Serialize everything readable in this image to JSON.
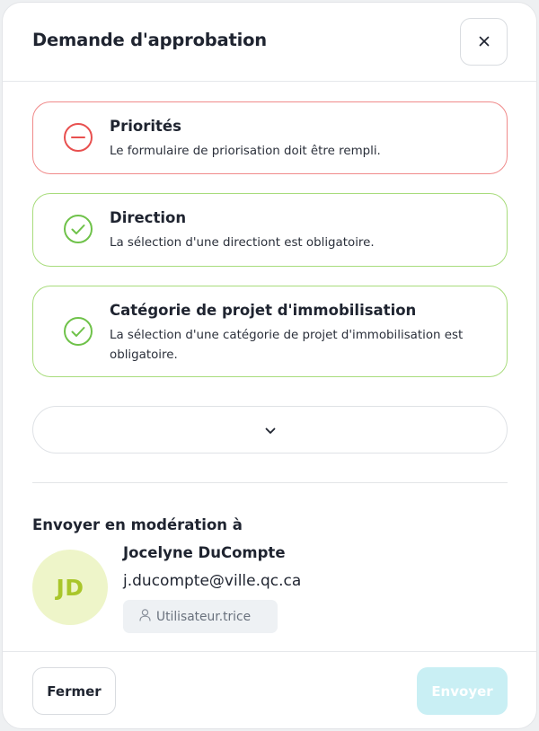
{
  "dialog": {
    "title": "Demande d'approbation",
    "close_icon": "close-icon"
  },
  "checks": [
    {
      "status": "error",
      "icon": "minus-circle-icon",
      "title": "Priorités",
      "description": "Le formulaire de priorisation doit être rempli."
    },
    {
      "status": "ok",
      "icon": "check-circle-icon",
      "title": "Direction",
      "description": "La sélection d'une directiont est obligatoire."
    },
    {
      "status": "ok",
      "icon": "check-circle-icon",
      "title": "Catégorie de projet d'immobilisation",
      "description": "La sélection d'une catégorie de projet d'immobilisation est obligatoire."
    }
  ],
  "expand": {
    "icon": "chevron-down-icon"
  },
  "moderation": {
    "title": "Envoyer en modération à",
    "user": {
      "initials": "JD",
      "name": "Jocelyne DuCompte",
      "email": "j.ducompte@ville.qc.ca",
      "role": "Utilisateur.trice",
      "role_icon": "user-icon"
    }
  },
  "footer": {
    "close_label": "Fermer",
    "send_label": "Envoyer"
  },
  "colors": {
    "error": "#f08a8a",
    "error_icon": "#e8504f",
    "success": "#a8dc7c",
    "success_icon": "#6fc24a",
    "avatar_bg": "#eef5c9",
    "avatar_text": "#a9c62a",
    "send_disabled_bg": "#c9eff4"
  }
}
